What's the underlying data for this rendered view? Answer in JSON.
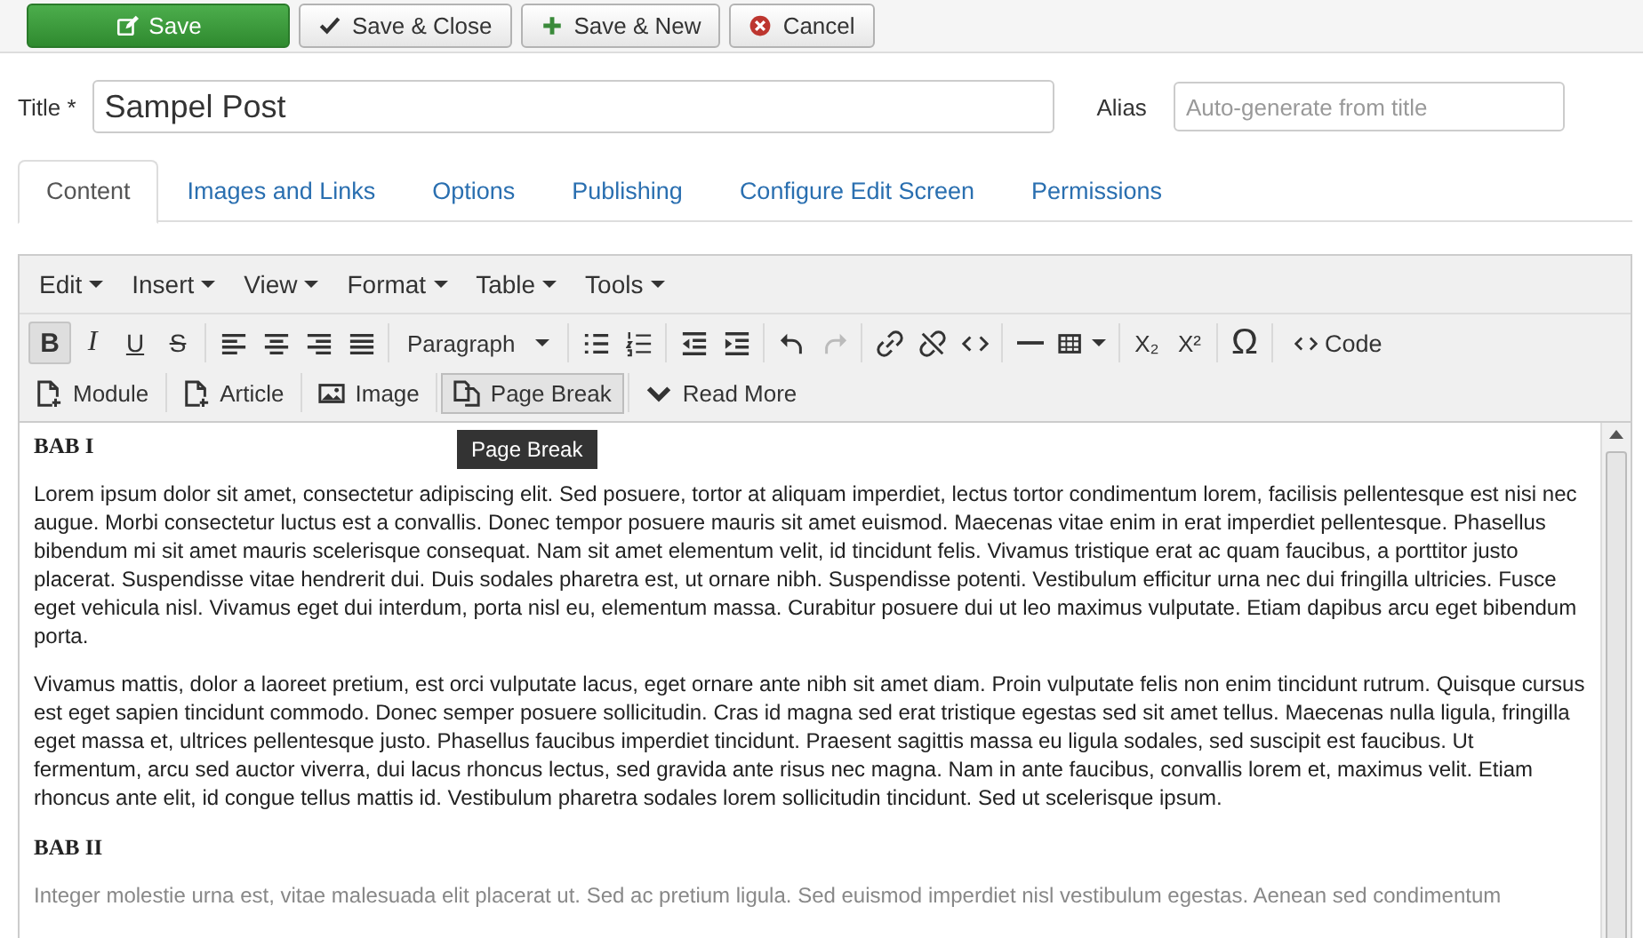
{
  "actions": [
    {
      "label": "Save",
      "kind": "primary"
    },
    {
      "label": "Save & Close",
      "kind": "default"
    },
    {
      "label": "Save & New",
      "kind": "default"
    },
    {
      "label": "Cancel",
      "kind": "default"
    }
  ],
  "title": {
    "label": "Title *",
    "value": "Sampel Post"
  },
  "alias": {
    "label": "Alias",
    "placeholder": "Auto-generate from title"
  },
  "tabs": [
    {
      "label": "Content",
      "selected": true
    },
    {
      "label": "Images and Links",
      "selected": false
    },
    {
      "label": "Options",
      "selected": false
    },
    {
      "label": "Publishing",
      "selected": false
    },
    {
      "label": "Configure Edit Screen",
      "selected": false
    },
    {
      "label": "Permissions",
      "selected": false
    }
  ],
  "editor": {
    "menubar": [
      "Edit",
      "Insert",
      "View",
      "Format",
      "Table",
      "Tools"
    ],
    "toolbar": [
      [
        {
          "kind": "glyph",
          "glyph": "B",
          "active": true,
          "disabled": false
        },
        {
          "kind": "glyph",
          "glyph": "I",
          "active": false,
          "disabled": false
        },
        {
          "kind": "glyph",
          "glyph": "U",
          "active": false,
          "disabled": false
        },
        {
          "kind": "glyph",
          "glyph": "S",
          "active": false,
          "disabled": false
        }
      ],
      [
        {
          "kind": "icon",
          "active": false,
          "disabled": false
        },
        {
          "kind": "icon",
          "active": false,
          "disabled": false
        },
        {
          "kind": "icon",
          "active": false,
          "disabled": false
        },
        {
          "kind": "icon",
          "active": false,
          "disabled": false
        }
      ],
      [
        {
          "kind": "select",
          "label": "Paragraph",
          "active": false,
          "disabled": false
        }
      ],
      [
        {
          "kind": "icon",
          "active": false,
          "disabled": false
        },
        {
          "kind": "icon",
          "active": false,
          "disabled": false
        }
      ],
      [
        {
          "kind": "icon",
          "active": false,
          "disabled": false
        },
        {
          "kind": "icon",
          "active": false,
          "disabled": false
        }
      ],
      [
        {
          "kind": "icon",
          "active": false,
          "disabled": false
        },
        {
          "kind": "icon",
          "active": false,
          "disabled": true
        }
      ],
      [
        {
          "kind": "icon",
          "active": false,
          "disabled": false
        },
        {
          "kind": "icon",
          "active": false,
          "disabled": false
        },
        {
          "kind": "icon",
          "active": false,
          "disabled": false
        }
      ],
      [
        {
          "kind": "icon",
          "active": false,
          "disabled": false
        },
        {
          "kind": "icon",
          "active": false,
          "disabled": false
        }
      ],
      [
        {
          "kind": "glyph",
          "glyph": "X₂",
          "active": false,
          "disabled": false
        },
        {
          "kind": "glyph",
          "glyph": "X²",
          "active": false,
          "disabled": false
        }
      ],
      [
        {
          "kind": "glyph",
          "glyph": "Ω",
          "active": false,
          "disabled": false
        }
      ],
      [
        {
          "kind": "labeled",
          "label": "Code",
          "active": false,
          "disabled": false
        }
      ]
    ],
    "buttons": [
      {
        "label": "Module",
        "hovered": false
      },
      {
        "label": "Article",
        "hovered": false
      },
      {
        "label": "Image",
        "hovered": false
      },
      {
        "label": "Page Break",
        "hovered": true
      },
      {
        "label": "Read More",
        "hovered": false
      }
    ],
    "tooltip": "Page Break",
    "content": [
      {
        "kind": "heading",
        "text": "BAB I"
      },
      {
        "kind": "paragraph",
        "text": "Lorem ipsum dolor sit amet, consectetur adipiscing elit. Sed posuere, tortor at aliquam imperdiet, lectus tortor condimentum lorem, facilisis pellentesque est nisi nec augue. Morbi consectetur luctus est a convallis. Donec tempor posuere mauris sit amet euismod. Maecenas vitae enim in erat imperdiet pellentesque. Phasellus bibendum mi sit amet mauris scelerisque consequat. Nam sit amet elementum velit, id tincidunt felis. Vivamus tristique erat ac quam faucibus, a porttitor justo placerat. Suspendisse vitae hendrerit dui. Duis sodales pharetra est, ut ornare nibh. Suspendisse potenti. Vestibulum efficitur urna nec dui fringilla ultricies. Fusce eget vehicula nisl. Vivamus eget dui interdum, porta nisl eu, elementum massa. Curabitur posuere dui ut leo maximus vulputate. Etiam dapibus arcu eget bibendum porta."
      },
      {
        "kind": "paragraph",
        "text": "Vivamus mattis, dolor a laoreet pretium, est orci vulputate lacus, eget ornare ante nibh sit amet diam. Proin vulputate felis non enim tincidunt rutrum. Quisque cursus est eget sapien tincidunt commodo. Donec semper posuere sollicitudin. Cras id magna sed erat tristique egestas sed sit amet tellus. Maecenas nulla ligula, fringilla eget massa et, ultrices pellentesque justo. Phasellus faucibus imperdiet tincidunt. Praesent sagittis massa eu ligula sodales, sed suscipit est faucibus. Ut fermentum, arcu sed auctor viverra, dui lacus rhoncus lectus, sed gravida ante risus nec magna. Nam in ante faucibus, convallis lorem et, maximus velit. Etiam rhoncus ante elit, id congue tellus mattis id. Vestibulum pharetra sodales lorem sollicitudin tincidunt. Sed ut scelerisque ipsum."
      },
      {
        "kind": "heading",
        "text": "BAB II"
      },
      {
        "kind": "muted",
        "text": "Integer molestie urna est, vitae malesuada elit placerat ut. Sed ac pretium ligula. Sed euismod imperdiet nisl vestibulum egestas. Aenean sed condimentum"
      }
    ]
  }
}
